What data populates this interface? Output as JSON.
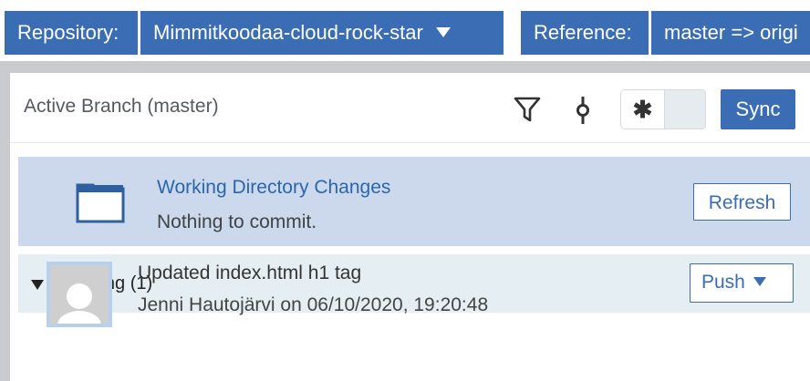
{
  "toolbar": {
    "repository_label": "Repository:",
    "repository_value": "Mimmitkoodaa-cloud-rock-star",
    "reference_label": "Reference:",
    "reference_value": "master => origi"
  },
  "header": {
    "title": "Active Branch (master)",
    "toggle_symbol": "✱",
    "sync_label": "Sync"
  },
  "working_directory": {
    "title": "Working Directory Changes",
    "subtitle": "Nothing to commit.",
    "refresh_label": "Refresh"
  },
  "outgoing": {
    "label": "Outgoing (1)",
    "push_label": "Push"
  },
  "commit": {
    "message": "Updated index.html h1 tag",
    "meta": "Jenni Hautojärvi on 06/10/2020, 19:20:48"
  },
  "colors": {
    "accent": "#3a6db3",
    "row_highlight": "#ccd9ec",
    "outgoing_bg": "#e4eef3"
  }
}
